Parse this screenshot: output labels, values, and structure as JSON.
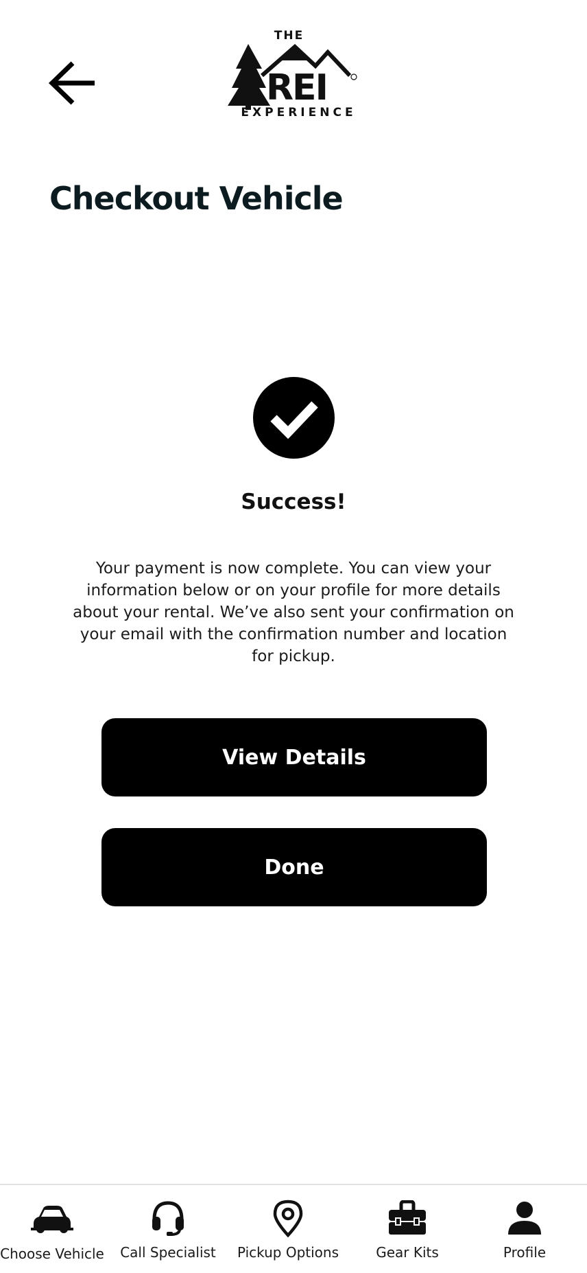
{
  "header": {
    "back_icon": "arrow-left-icon",
    "logo": {
      "top": "THE",
      "main": "REI",
      "bottom": "EXPERIENCE",
      "registered": "®"
    }
  },
  "page": {
    "title": "Checkout Vehicle"
  },
  "success": {
    "icon": "check-circle-icon",
    "title": "Success!",
    "message": "Your payment is now complete. You can view your information below or on your profile for more details about your rental. We’ve also sent your confirmation on your email with the confirmation number and location for pickup."
  },
  "actions": {
    "view_details_label": "View Details",
    "done_label": "Done"
  },
  "tabbar": {
    "items": [
      {
        "label": "Choose Vehicle",
        "icon": "car-icon"
      },
      {
        "label": "Call Specialist",
        "icon": "headset-icon"
      },
      {
        "label": "Pickup Options",
        "icon": "map-pin-icon"
      },
      {
        "label": "Gear Kits",
        "icon": "toolbox-icon"
      },
      {
        "label": "Profile",
        "icon": "user-icon"
      }
    ]
  },
  "colors": {
    "primary": "#000000",
    "background": "#ffffff",
    "title": "#0b1b1f",
    "divider": "#e2e2e2"
  }
}
